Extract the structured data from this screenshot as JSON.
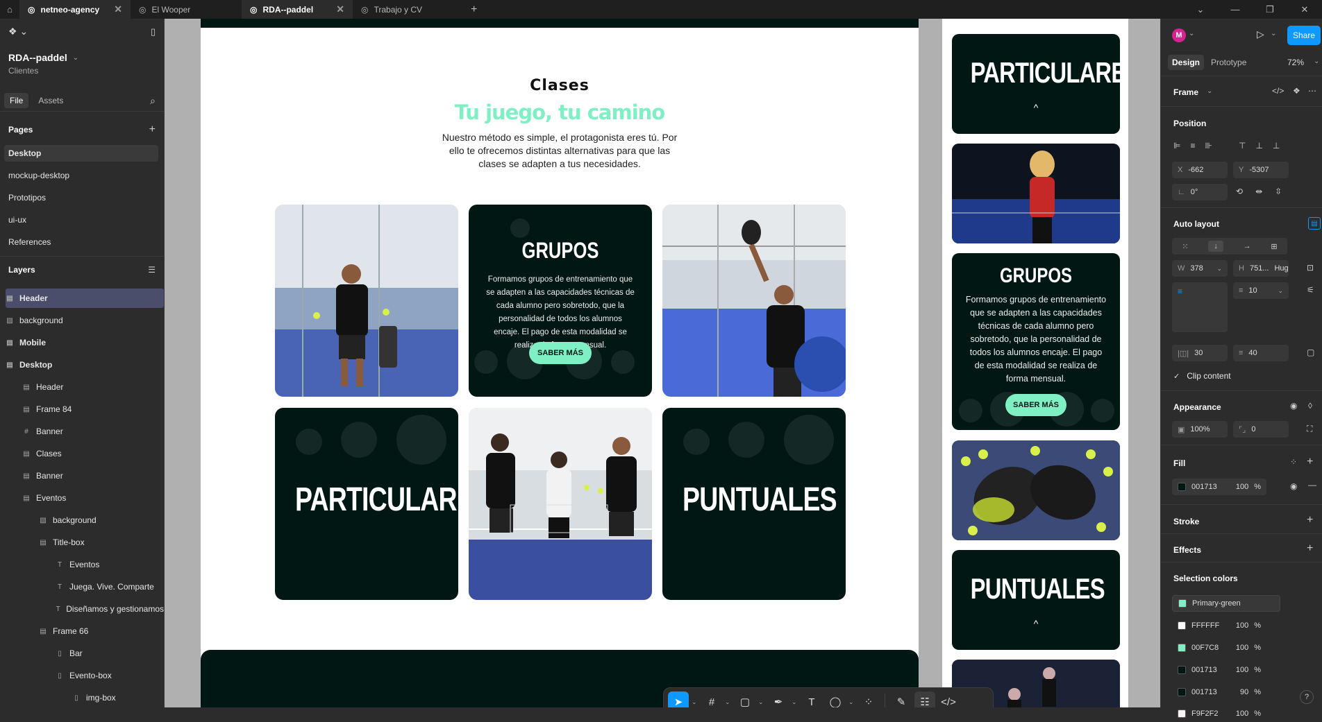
{
  "tabs": [
    {
      "label": "netneo-agency",
      "active": false
    },
    {
      "label": "El Wooper",
      "active": false
    },
    {
      "label": "RDA--paddel",
      "active": true
    },
    {
      "label": "Trabajo y CV",
      "active": false
    }
  ],
  "left": {
    "project_name": "RDA--paddel",
    "project_team": "Clientes",
    "file_tab": "File",
    "assets_tab": "Assets",
    "pages_heading": "Pages",
    "pages": [
      "Desktop",
      "mockup-desktop",
      "Prototipos",
      "ui-ux",
      "References"
    ],
    "layers_heading": "Layers",
    "layers": [
      {
        "label": "Header",
        "icon": "auto-layout-icon"
      },
      {
        "label": "background",
        "icon": "image-icon"
      },
      {
        "label": "Mobile",
        "icon": "auto-layout-icon"
      },
      {
        "label": "Desktop",
        "icon": "auto-layout-icon"
      },
      {
        "label": "Header",
        "icon": "auto-layout-icon"
      },
      {
        "label": "Frame 84",
        "icon": "auto-layout-icon"
      },
      {
        "label": "Banner",
        "icon": "frame-icon"
      },
      {
        "label": "Clases",
        "icon": "auto-layout-icon"
      },
      {
        "label": "Banner",
        "icon": "auto-layout-icon"
      },
      {
        "label": "Eventos",
        "icon": "auto-layout-icon"
      },
      {
        "label": "background",
        "icon": "image-icon"
      },
      {
        "label": "Title-box",
        "icon": "auto-layout-icon"
      },
      {
        "label": "Eventos",
        "icon": "text-icon"
      },
      {
        "label": "Juega. Vive. Comparte",
        "icon": "text-icon"
      },
      {
        "label": "Diseñamos y gestionamos",
        "icon": "text-icon"
      },
      {
        "label": "Frame 66",
        "icon": "auto-layout-icon"
      },
      {
        "label": "Bar",
        "icon": "column-icon"
      },
      {
        "label": "Evento-box",
        "icon": "column-icon"
      },
      {
        "label": "img-box",
        "icon": "column-icon"
      }
    ]
  },
  "canvas": {
    "clases_title": "Clases",
    "clases_subtitle": "Tu juego, tu camino",
    "clases_desc": "Nuestro método es simple, el protagonista eres tú. Por ello te ofrecemos distintas alternativas para que las clases se adapten a tus necesidades.",
    "grupos_title": "GRUPOS",
    "grupos_text": "Formamos grupos de entrenamiento que se adapten a las capacidades técnicas de cada alumno pero sobretodo, que la personalidad de todos los alumnos encaje. El pago de esta modalidad se realiza de forma mensual.",
    "saber_mas": "SABER MÁS",
    "particulares": "PARTICULARES",
    "puntuales": "PUNTUALES",
    "chevron": "^"
  },
  "toolbar": {
    "tools": [
      "move-tool-icon",
      "frame-tool-icon",
      "rectangle-tool-icon",
      "pen-tool-icon",
      "text-tool-icon",
      "comment-tool-icon",
      "components-tool-icon",
      "draw-icon",
      "design-mode-icon",
      "dev-mode-icon"
    ]
  },
  "right": {
    "avatar_letter": "M",
    "share_label": "Share",
    "design_tab": "Design",
    "prototype_tab": "Prototype",
    "zoom": "72%",
    "frame_label": "Frame",
    "position_heading": "Position",
    "x_label": "X",
    "x_value": "-662",
    "y_label": "Y",
    "y_value": "-5307",
    "rotation": "0°",
    "auto_layout_heading": "Auto layout",
    "w_label": "W",
    "w_value": "378",
    "h_label": "H",
    "h_value": "751...",
    "h_mode": "Hug",
    "gap": "10",
    "pad_h": "30",
    "pad_v": "40",
    "clip_label": "Clip content",
    "appearance_heading": "Appearance",
    "opacity": "100%",
    "radius": "0",
    "fill_heading": "Fill",
    "fill_hex": "001713",
    "fill_opacity": "100",
    "percent": "%",
    "stroke_heading": "Stroke",
    "effects_heading": "Effects",
    "selection_colors_heading": "Selection colors",
    "selection_colors": [
      {
        "name": "Primary-green",
        "color": "#7ef0c4",
        "opacity": ""
      },
      {
        "name": "FFFFFF",
        "color": "#ffffff",
        "opacity": "100"
      },
      {
        "name": "00F7C8",
        "color": "#7ef0c4",
        "opacity": "100"
      },
      {
        "name": "001713",
        "color": "#001713",
        "opacity": "100"
      },
      {
        "name": "001713",
        "color": "#001713",
        "opacity": "90"
      },
      {
        "name": "F9F2F2",
        "color": "#f9f2f2",
        "opacity": "100"
      }
    ]
  },
  "colors": {
    "dark": "#001713",
    "accent": "#7ef0c4",
    "figma_blue": "#0d99ff"
  }
}
